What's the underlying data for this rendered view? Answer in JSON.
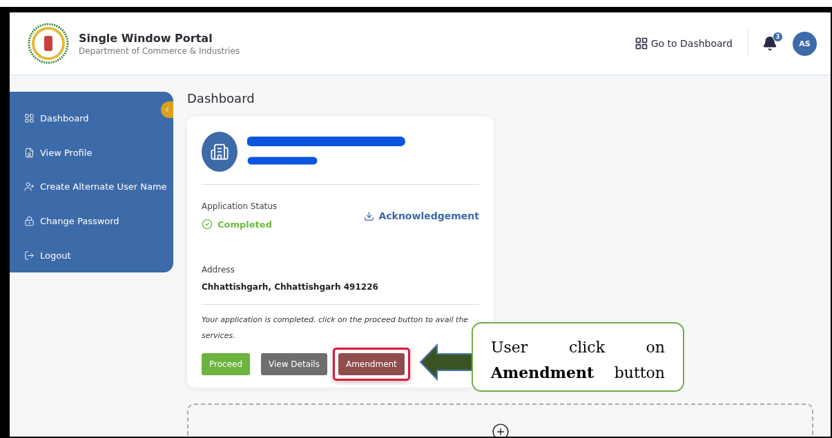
{
  "header": {
    "title": "Single Window Portal",
    "subtitle": "Department of Commerce & Industries",
    "dashboard_link": "Go to Dashboard",
    "notification_count": "3",
    "avatar": "AS"
  },
  "sidebar": {
    "items": [
      {
        "label": "Dashboard"
      },
      {
        "label": "View Profile"
      },
      {
        "label": "Create Alternate User Name"
      },
      {
        "label": "Change Password"
      },
      {
        "label": "Logout"
      }
    ]
  },
  "page_title": "Dashboard",
  "card": {
    "status_label": "Application Status",
    "status": "Completed",
    "acknowledgement": "Acknowledgement",
    "address_label": "Address",
    "address": "Chhattishgarh, Chhattishgarh 491226",
    "note": "Your application is completed. click on the proceed button to avail the services.",
    "buttons": [
      {
        "label": "Proceed",
        "kind": "proceed",
        "highlighted": false
      },
      {
        "label": "View Details",
        "kind": "details",
        "highlighted": false
      },
      {
        "label": "Amendment",
        "kind": "amendment",
        "highlighted": true
      }
    ]
  },
  "callout": {
    "text": "User click on **Amendment** button"
  }
}
